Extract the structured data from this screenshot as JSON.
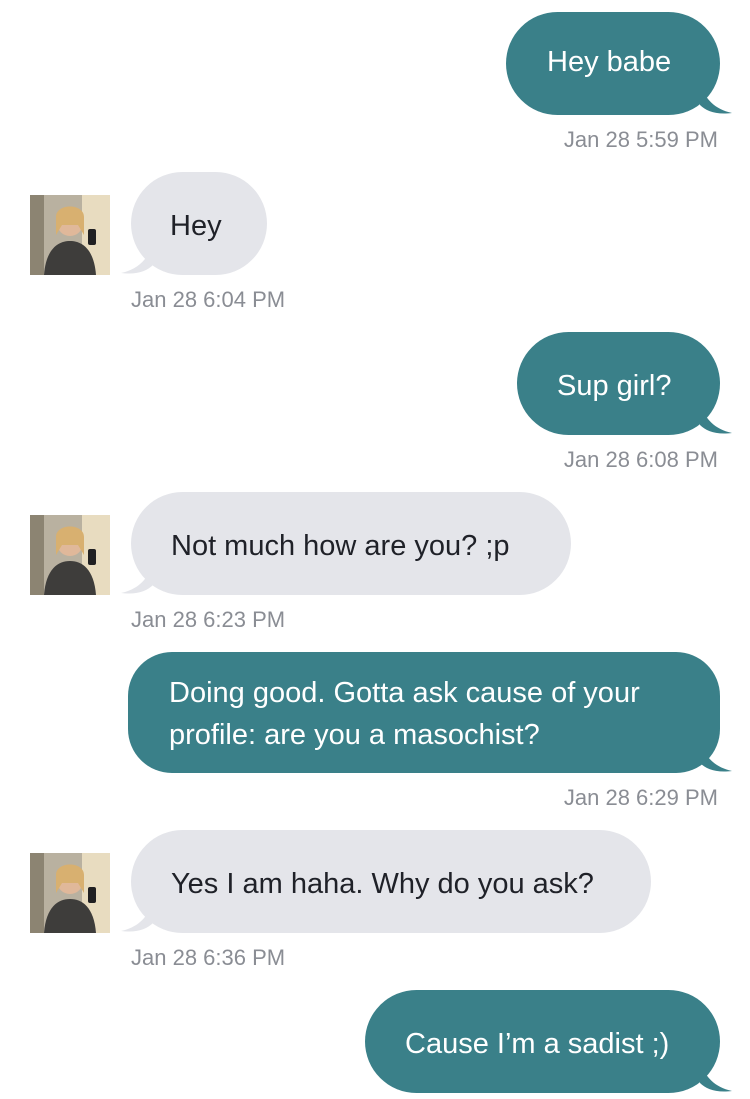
{
  "colors": {
    "sent_bubble": "#3a8089",
    "received_bubble": "#e4e5ea",
    "timestamp": "#8a8d94"
  },
  "messages": [
    {
      "direction": "sent",
      "text": "Hey babe",
      "time": "Jan 28 5:59 PM"
    },
    {
      "direction": "received",
      "text": "Hey",
      "time": "Jan 28 6:04 PM",
      "avatar": "contact-avatar"
    },
    {
      "direction": "sent",
      "text": "Sup girl?",
      "time": "Jan 28 6:08 PM"
    },
    {
      "direction": "received",
      "text": "Not much how are you? ;p",
      "time": "Jan 28 6:23 PM",
      "avatar": "contact-avatar"
    },
    {
      "direction": "sent",
      "text": "Doing good. Gotta ask cause of your profile: are you a masochist?",
      "time": "Jan 28 6:29 PM"
    },
    {
      "direction": "received",
      "text": "Yes I am haha. Why do you ask?",
      "time": "Jan 28 6:36 PM",
      "avatar": "contact-avatar"
    },
    {
      "direction": "sent",
      "text": "Cause I’m a sadist ;)",
      "time": ""
    }
  ]
}
